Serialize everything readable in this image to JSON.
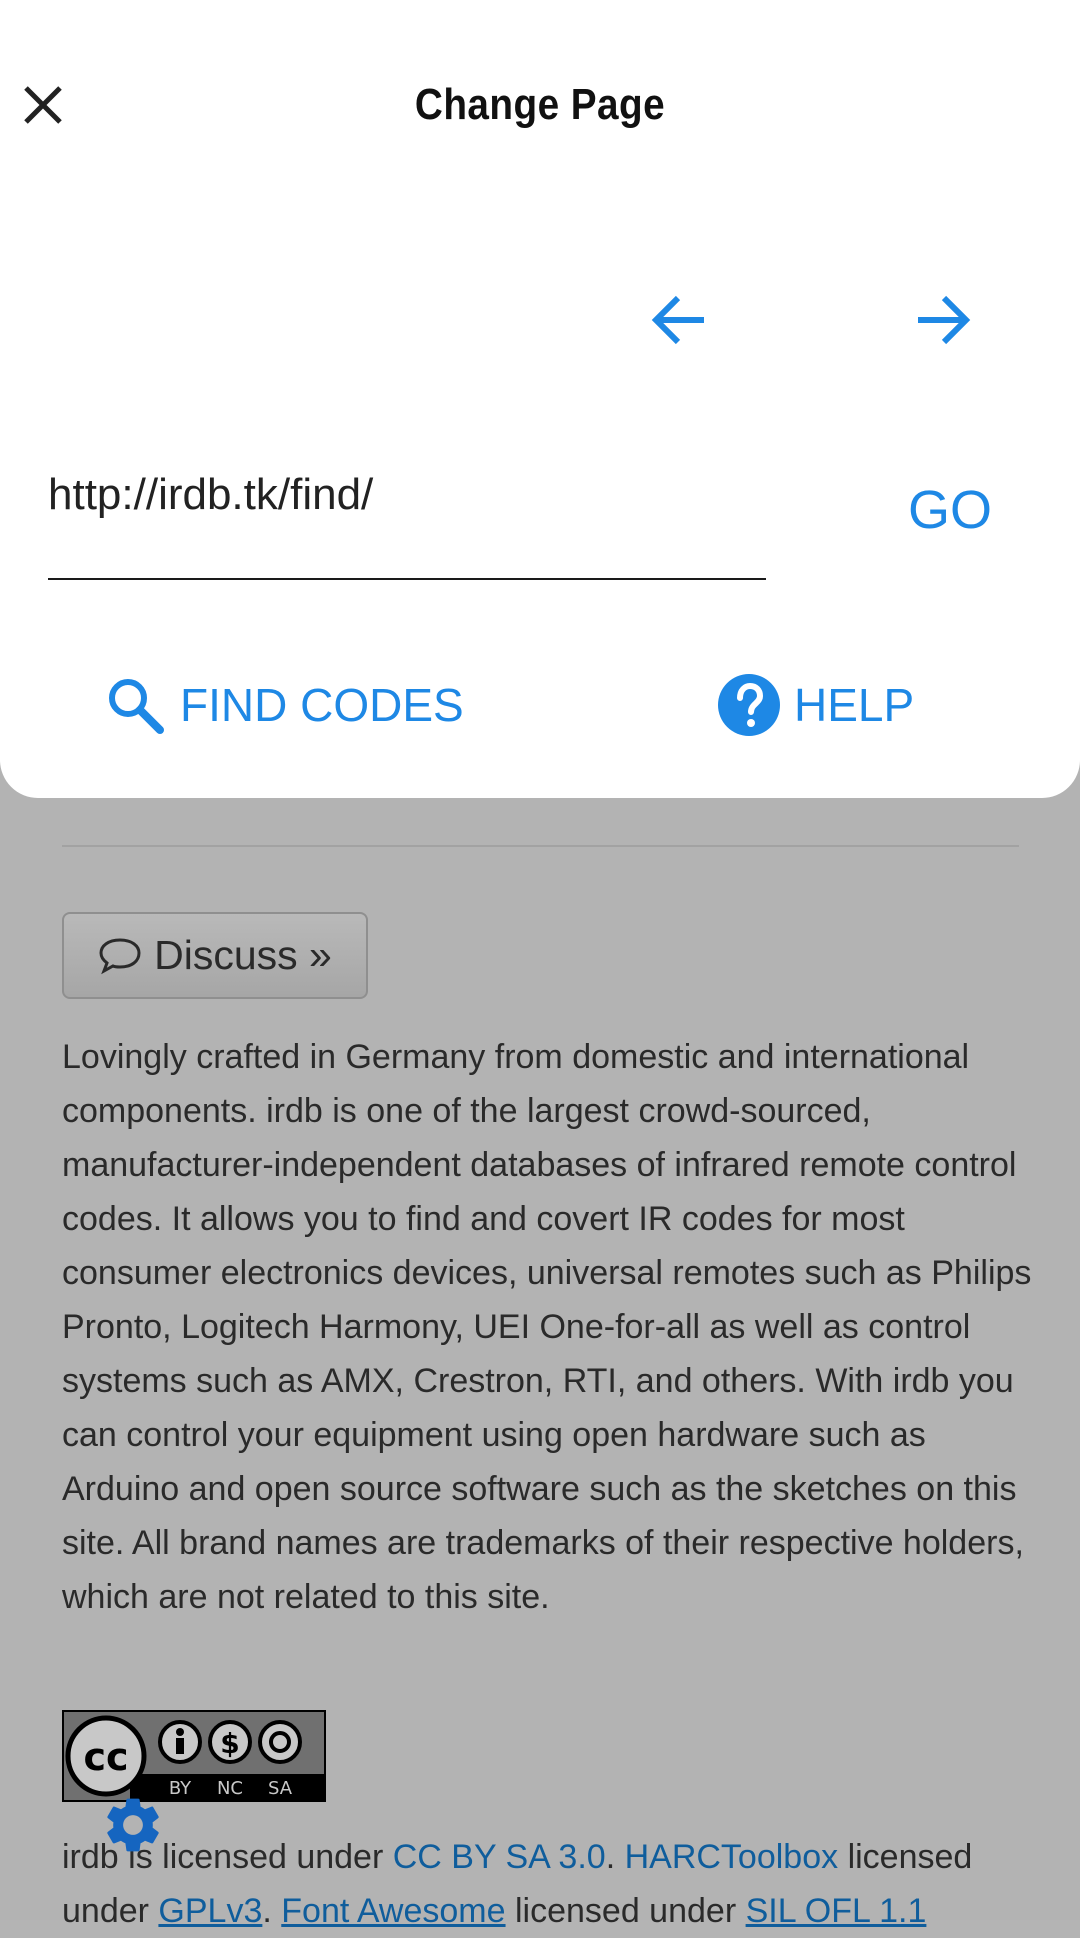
{
  "modal": {
    "title": "Change Page",
    "url_value": "http://irdb.tk/find/",
    "go_label": "GO",
    "find_codes_label": "FIND CODES",
    "help_label": "HELP"
  },
  "page": {
    "discuss_label": "Discuss »",
    "about_text": "Lovingly crafted in Germany from domestic and international components. irdb is one of the largest crowd-sourced, manufacturer-independent databases of infrared remote control codes. It allows you to find and covert IR codes for most consumer electronics devices, universal remotes such as Philips Pronto, Logitech Harmony, UEI One-for-all as well as control systems such as AMX, Crestron, RTI, and others. With irdb you can control your equipment using open hardware such as Arduino and open source software such as the sketches on this site. All brand names are trademarks of their respective holders, which are not related to this site.",
    "license": {
      "part1": "irdb is licensed under ",
      "link1": "CC BY SA 3.0",
      "sep1": ". ",
      "link2": "HARCToolbox",
      "part2": " licensed",
      "part3": "under ",
      "link3": "GPLv3",
      "sep2": ". ",
      "link4": "Font Awesome",
      "part4": " licensed under ",
      "link5": "SIL OFL 1.1"
    },
    "cc_badge": {
      "main": "cc",
      "labels": [
        "BY",
        "NC",
        "SA"
      ]
    }
  },
  "colors": {
    "accent": "#1e88e5",
    "link": "#0f5d9c",
    "overlay_bg": "#b3b3b3",
    "modal_bg": "#ffffff"
  },
  "icons": {
    "close": "close-icon",
    "back": "arrow-left-icon",
    "forward": "arrow-right-icon",
    "search": "search-icon",
    "help": "help-circle-icon",
    "comment": "comment-icon",
    "settings": "gear-icon"
  }
}
